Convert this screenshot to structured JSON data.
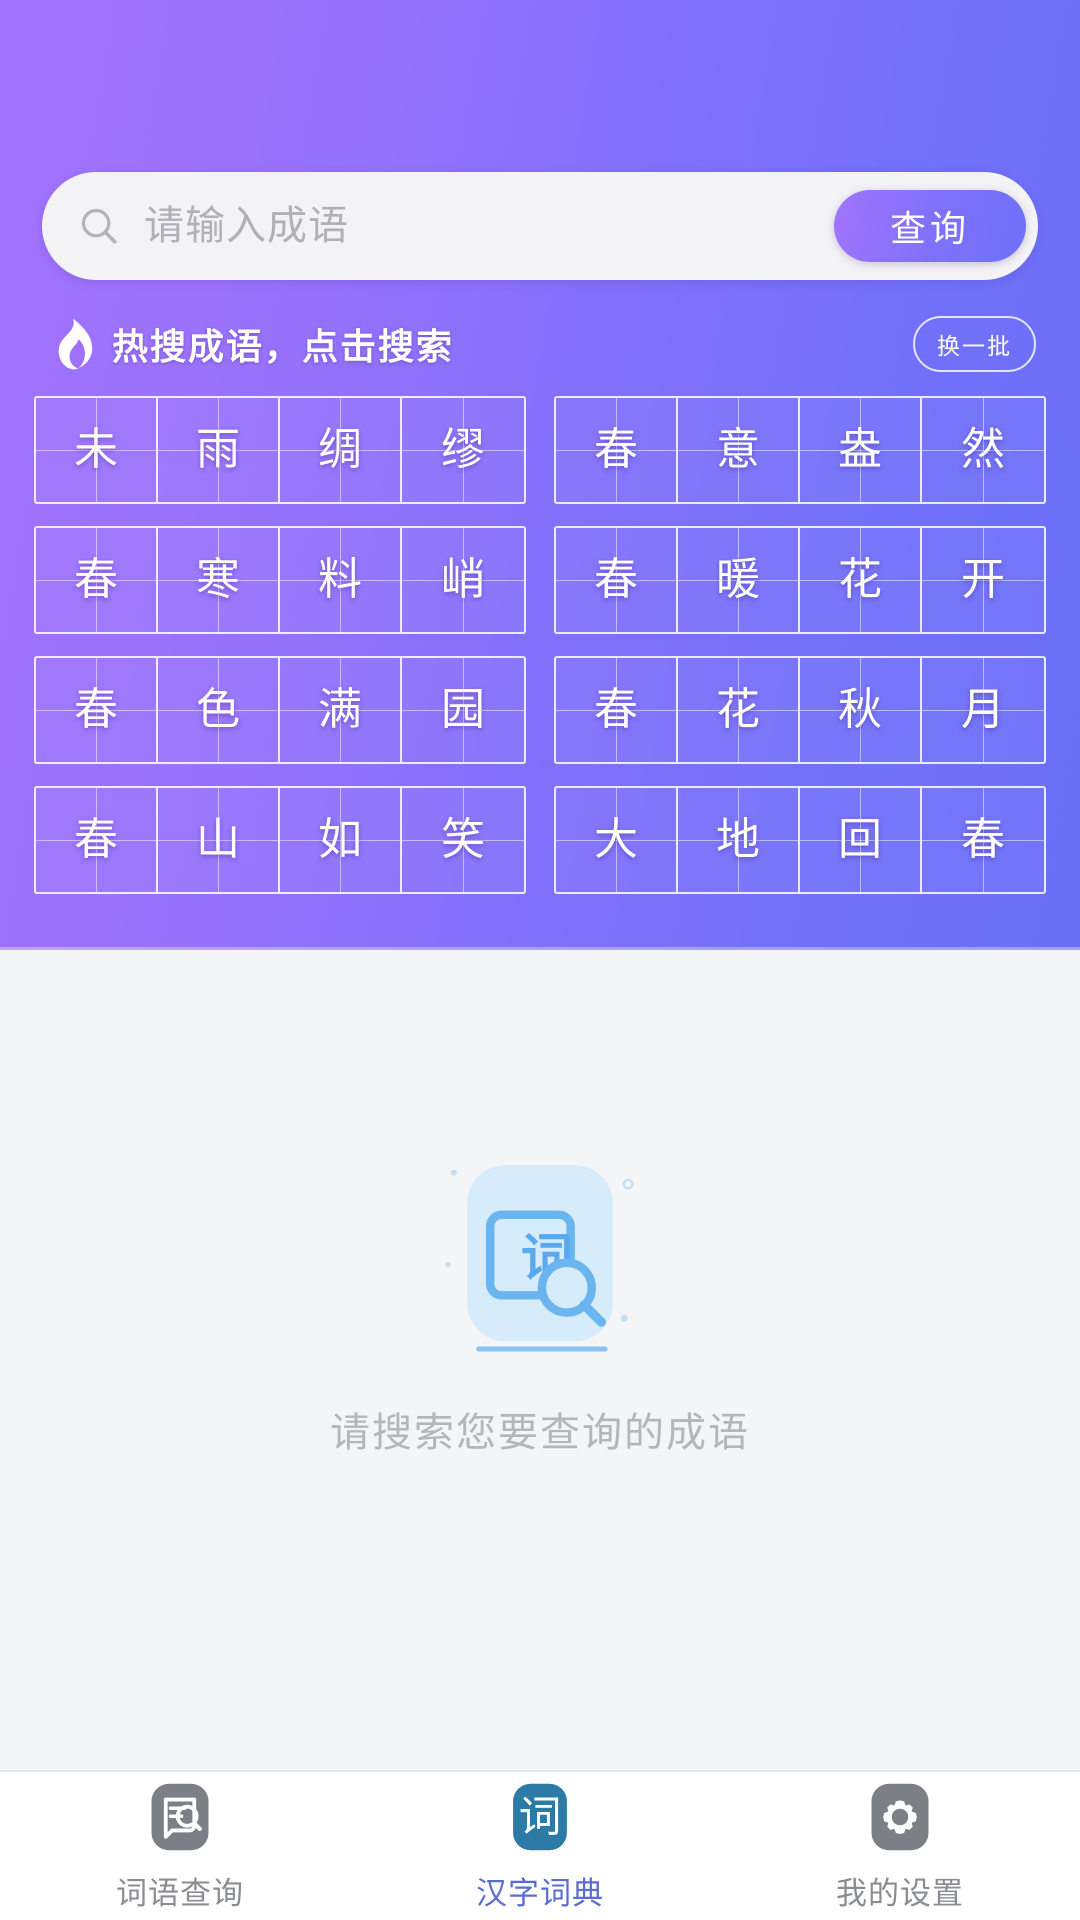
{
  "theme": {
    "gradient_start": "#a173fd",
    "gradient_end": "#6a6ff8",
    "content_bg": "#f4f5f7",
    "active_tab_color": "#5a6ed2",
    "active_tab_icon_bg": "#2c7ba6",
    "inactive_tab_color": "#8b8d92",
    "empty_icon_color": "#6ab4ef"
  },
  "search": {
    "placeholder": "请输入成语",
    "value": "",
    "button_label": "查询",
    "icon": "search-icon"
  },
  "hot_section": {
    "icon": "flame-icon",
    "title": "热搜成语，点击搜索",
    "refresh_label": "换一批",
    "idioms": [
      {
        "text": "未雨绸缪",
        "chars": [
          "未",
          "雨",
          "绸",
          "缪"
        ]
      },
      {
        "text": "春意盎然",
        "chars": [
          "春",
          "意",
          "盎",
          "然"
        ]
      },
      {
        "text": "春寒料峭",
        "chars": [
          "春",
          "寒",
          "料",
          "峭"
        ]
      },
      {
        "text": "春暖花开",
        "chars": [
          "春",
          "暖",
          "花",
          "开"
        ]
      },
      {
        "text": "春色满园",
        "chars": [
          "春",
          "色",
          "满",
          "园"
        ]
      },
      {
        "text": "春花秋月",
        "chars": [
          "春",
          "花",
          "秋",
          "月"
        ]
      },
      {
        "text": "春山如笑",
        "chars": [
          "春",
          "山",
          "如",
          "笑"
        ]
      },
      {
        "text": "大地回春",
        "chars": [
          "大",
          "地",
          "回",
          "春"
        ]
      }
    ]
  },
  "empty_state": {
    "icon": "dictionary-search-icon",
    "icon_char": "词",
    "message": "请搜索您要查询的成语"
  },
  "tabbar": {
    "items": [
      {
        "label": "词语查询",
        "icon": "word-lookup-icon",
        "active": false
      },
      {
        "label": "汉字词典",
        "icon": "character-dictionary-icon",
        "icon_char": "词",
        "active": true
      },
      {
        "label": "我的设置",
        "icon": "gear-icon",
        "active": false
      }
    ]
  }
}
